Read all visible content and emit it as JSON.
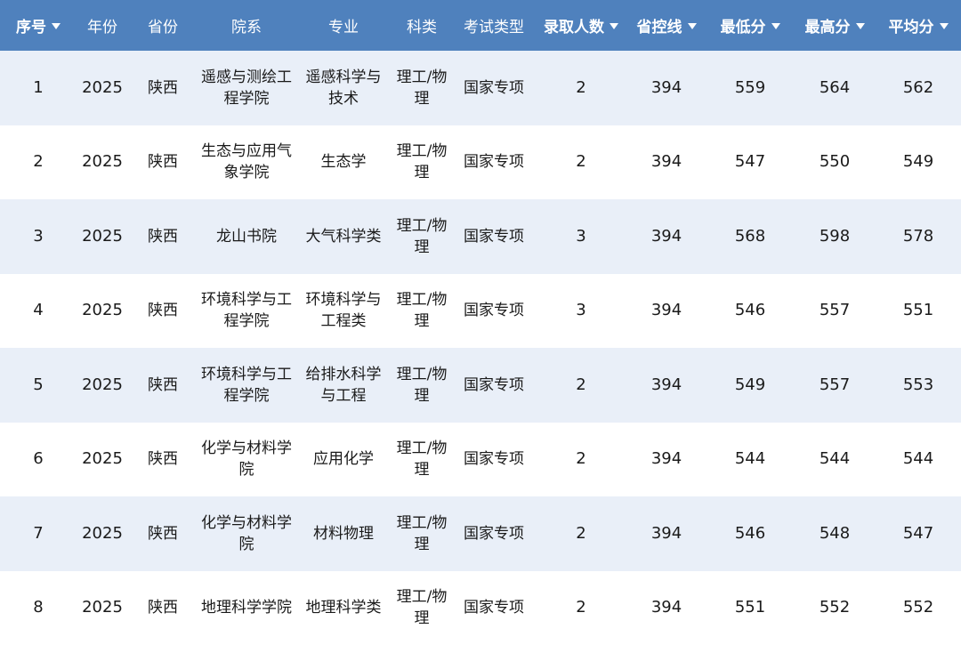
{
  "headers": [
    {
      "label": "序号",
      "sortable": true
    },
    {
      "label": "年份",
      "sortable": false
    },
    {
      "label": "省份",
      "sortable": false
    },
    {
      "label": "院系",
      "sortable": false
    },
    {
      "label": "专业",
      "sortable": false
    },
    {
      "label": "科类",
      "sortable": false
    },
    {
      "label": "考试类型",
      "sortable": false
    },
    {
      "label": "录取人数",
      "sortable": true
    },
    {
      "label": "省控线",
      "sortable": true
    },
    {
      "label": "最低分",
      "sortable": true
    },
    {
      "label": "最高分",
      "sortable": true
    },
    {
      "label": "平均分",
      "sortable": true
    }
  ],
  "rows": [
    [
      "1",
      "2025",
      "陕西",
      "遥感与测绘工程学院",
      "遥感科学与技术",
      "理工/物理",
      "国家专项",
      "2",
      "394",
      "559",
      "564",
      "562"
    ],
    [
      "2",
      "2025",
      "陕西",
      "生态与应用气象学院",
      "生态学",
      "理工/物理",
      "国家专项",
      "2",
      "394",
      "547",
      "550",
      "549"
    ],
    [
      "3",
      "2025",
      "陕西",
      "龙山书院",
      "大气科学类",
      "理工/物理",
      "国家专项",
      "3",
      "394",
      "568",
      "598",
      "578"
    ],
    [
      "4",
      "2025",
      "陕西",
      "环境科学与工程学院",
      "环境科学与工程类",
      "理工/物理",
      "国家专项",
      "3",
      "394",
      "546",
      "557",
      "551"
    ],
    [
      "5",
      "2025",
      "陕西",
      "环境科学与工程学院",
      "给排水科学与工程",
      "理工/物理",
      "国家专项",
      "2",
      "394",
      "549",
      "557",
      "553"
    ],
    [
      "6",
      "2025",
      "陕西",
      "化学与材料学院",
      "应用化学",
      "理工/物理",
      "国家专项",
      "2",
      "394",
      "544",
      "544",
      "544"
    ],
    [
      "7",
      "2025",
      "陕西",
      "化学与材料学院",
      "材料物理",
      "理工/物理",
      "国家专项",
      "2",
      "394",
      "546",
      "548",
      "547"
    ],
    [
      "8",
      "2025",
      "陕西",
      "地理科学学院",
      "地理科学类",
      "理工/物理",
      "国家专项",
      "2",
      "394",
      "551",
      "552",
      "552"
    ]
  ],
  "colors": {
    "header_bg": "#4f81bd",
    "header_text": "#ffffff",
    "row_odd": "#e9eff8",
    "row_even": "#ffffff"
  }
}
